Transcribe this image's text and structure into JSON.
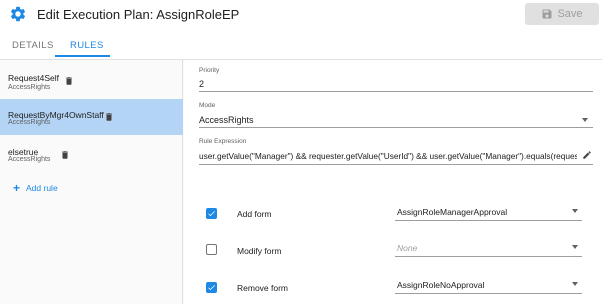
{
  "header": {
    "icon": "gear-icon",
    "title": "Edit Execution Plan: AssignRoleEP",
    "save_label": "Save"
  },
  "tabs": [
    {
      "label": "DETAILS",
      "active": false
    },
    {
      "label": "RULES",
      "active": true
    }
  ],
  "rules": [
    {
      "name": "Request4Self",
      "sub": "AccessRights",
      "selected": false
    },
    {
      "name": "RequestByMgr4OwnStaff",
      "sub": "AccessRights",
      "selected": true
    },
    {
      "name": "elsetrue",
      "sub": "AccessRights",
      "selected": false
    }
  ],
  "add_rule_label": "Add rule",
  "fields": {
    "priority": {
      "label": "Priority",
      "value": "2"
    },
    "mode": {
      "label": "Mode",
      "value": "AccessRights"
    },
    "rule_expression": {
      "label": "Rule Expression",
      "value": "user.getValue(\"Manager\") && requester.getValue(\"UserId\") && user.getValue(\"Manager\").equals(requeste..."
    }
  },
  "forms": [
    {
      "label": "Add form",
      "checked": true,
      "value": "AssignRoleManagerApproval",
      "placeholder": false
    },
    {
      "label": "Modify form",
      "checked": false,
      "value": "None",
      "placeholder": true
    },
    {
      "label": "Remove form",
      "checked": true,
      "value": "AssignRoleNoApproval",
      "placeholder": false
    }
  ],
  "colors": {
    "accent": "#1e88e5",
    "selected_row": "#b3d4f5"
  }
}
